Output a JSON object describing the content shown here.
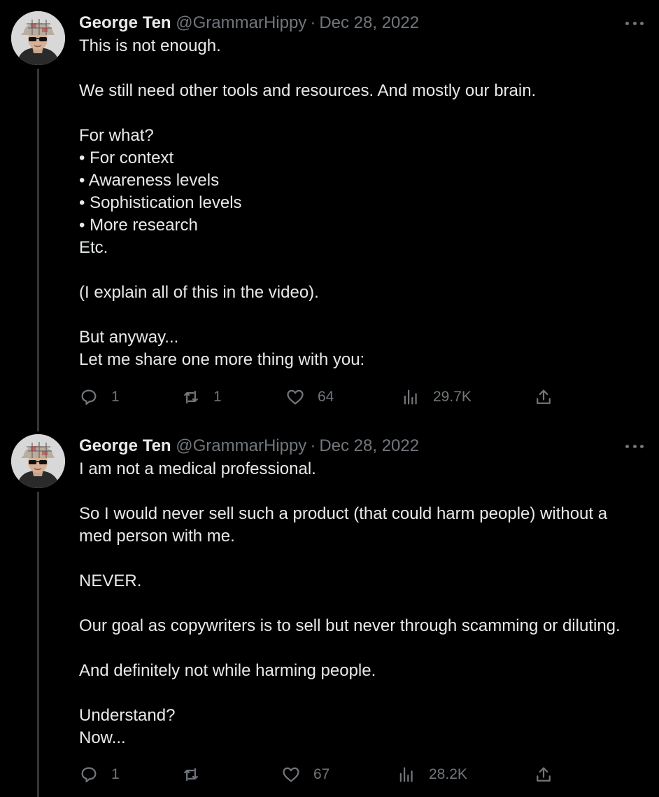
{
  "tweets": [
    {
      "author": "George Ten",
      "handle": "@GrammarHippy",
      "separator": "·",
      "date": "Dec 28, 2022",
      "lines": [
        "This is not enough.",
        "",
        "We still need other tools and resources. And mostly our brain.",
        "",
        "For what?",
        "• For context",
        "• Awareness levels",
        "• Sophistication levels",
        "• More research",
        "Etc.",
        "",
        "(I explain all of this in the video).",
        "",
        "But anyway...",
        "Let me share one more thing with you:"
      ],
      "replies": "1",
      "retweets": "1",
      "likes": "64",
      "views": "29.7K"
    },
    {
      "author": "George Ten",
      "handle": "@GrammarHippy",
      "separator": "·",
      "date": "Dec 28, 2022",
      "lines": [
        "I am not a medical professional.",
        "",
        "So I would never sell such a product (that could harm people) without a",
        "med person with me.",
        "",
        "NEVER.",
        "",
        "Our goal as copywriters is to sell but never through scamming or diluting.",
        "",
        "And definitely not while harming people.",
        "",
        "Understand?",
        "Now..."
      ],
      "replies": "1",
      "retweets": "",
      "likes": "67",
      "views": "28.2K"
    }
  ],
  "icons": {
    "reply": "reply-icon",
    "retweet": "retweet-icon",
    "like": "heart-icon",
    "views": "views-icon",
    "share": "share-icon",
    "more": "more-icon"
  },
  "colors": {
    "background": "#000000",
    "text": "#e7e9ea",
    "muted": "#71767b",
    "thread_line": "#333639"
  }
}
